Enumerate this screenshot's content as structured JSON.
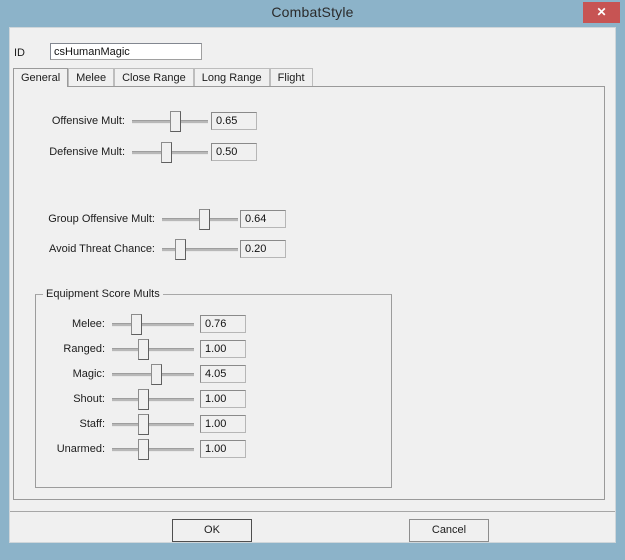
{
  "window": {
    "title": "CombatStyle",
    "close_icon": "close-icon",
    "close_glyph": "✕",
    "frame_color": "#8cb3c9",
    "close_color": "#c75453",
    "client_color": "#f0f0f0"
  },
  "id_field": {
    "label": "ID",
    "value": "csHumanMagic",
    "placeholder": ""
  },
  "tabs": [
    {
      "label": "General",
      "active": true
    },
    {
      "label": "Melee",
      "active": false
    },
    {
      "label": "Close Range",
      "active": false
    },
    {
      "label": "Long Range",
      "active": false
    },
    {
      "label": "Flight",
      "active": false
    }
  ],
  "main_sliders": [
    {
      "label": "Offensive Mult:",
      "value": "0.65",
      "fill": 0.58
    },
    {
      "label": "Defensive Mult:",
      "value": "0.50",
      "fill": 0.44
    }
  ],
  "group_sliders": [
    {
      "label": "Group Offensive Mult:",
      "value": "0.64",
      "fill": 0.57
    },
    {
      "label": "Avoid Threat Chance:",
      "value": "0.20",
      "fill": 0.2
    }
  ],
  "equipment_group": {
    "title": "Equipment Score Mults",
    "rows": [
      {
        "label": "Melee:",
        "value": "0.76",
        "fill": 0.27
      },
      {
        "label": "Ranged:",
        "value": "1.00",
        "fill": 0.36
      },
      {
        "label": "Magic:",
        "value": "4.05",
        "fill": 0.55
      },
      {
        "label": "Shout:",
        "value": "1.00",
        "fill": 0.36
      },
      {
        "label": "Staff:",
        "value": "1.00",
        "fill": 0.36
      },
      {
        "label": "Unarmed:",
        "value": "1.00",
        "fill": 0.36
      }
    ]
  },
  "buttons": {
    "ok": "OK",
    "cancel": "Cancel"
  }
}
